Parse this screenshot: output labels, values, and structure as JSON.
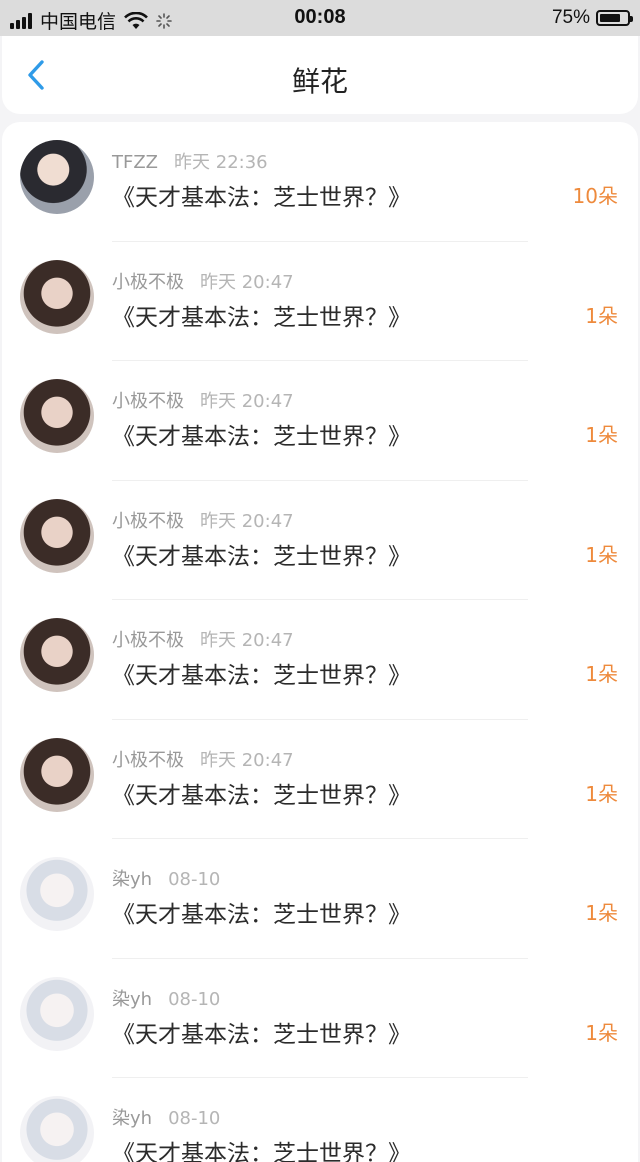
{
  "status_bar": {
    "carrier": "中国电信",
    "time": "00:08",
    "battery": "75%",
    "battery_level": 0.75
  },
  "header": {
    "title": "鲜花"
  },
  "rows": [
    {
      "user": "TFZZ",
      "time": "昨天 22:36",
      "book": "《天才基本法：芝士世界？》",
      "count": "10朵",
      "avatar": "avatar-boy"
    },
    {
      "user": "小极不极",
      "time": "昨天 20:47",
      "book": "《天才基本法：芝士世界？》",
      "count": "1朵",
      "avatar": "avatar-girl"
    },
    {
      "user": "小极不极",
      "time": "昨天 20:47",
      "book": "《天才基本法：芝士世界？》",
      "count": "1朵",
      "avatar": "avatar-girl"
    },
    {
      "user": "小极不极",
      "time": "昨天 20:47",
      "book": "《天才基本法：芝士世界？》",
      "count": "1朵",
      "avatar": "avatar-girl"
    },
    {
      "user": "小极不极",
      "time": "昨天 20:47",
      "book": "《天才基本法：芝士世界？》",
      "count": "1朵",
      "avatar": "avatar-girl"
    },
    {
      "user": "小极不极",
      "time": "昨天 20:47",
      "book": "《天才基本法：芝士世界？》",
      "count": "1朵",
      "avatar": "avatar-girl"
    },
    {
      "user": "染yh",
      "time": "08-10",
      "book": "《天才基本法：芝士世界？》",
      "count": "1朵",
      "avatar": "avatar-anime"
    },
    {
      "user": "染yh",
      "time": "08-10",
      "book": "《天才基本法：芝士世界？》",
      "count": "1朵",
      "avatar": "avatar-anime"
    },
    {
      "user": "染yh",
      "time": "08-10",
      "book": "《天才基本法：芝士世界？》",
      "count": "",
      "avatar": "avatar-anime"
    }
  ]
}
